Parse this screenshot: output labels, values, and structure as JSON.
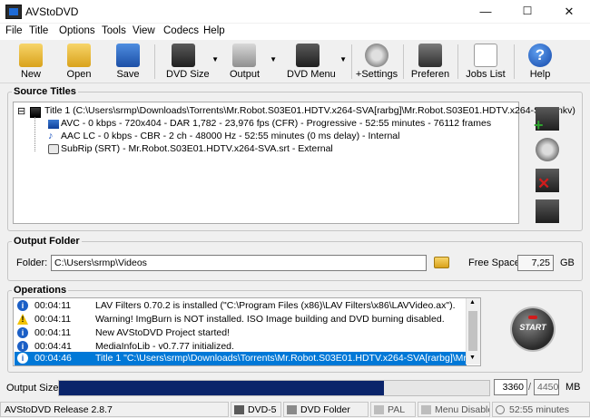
{
  "window": {
    "title": "AVStoDVD",
    "minimize": "—",
    "maximize": "☐",
    "close": "✕"
  },
  "menu": [
    "File",
    "Title",
    "Options",
    "Tools",
    "View",
    "Codecs",
    "Help"
  ],
  "toolbar": {
    "new": "New",
    "open": "Open",
    "save": "Save",
    "dvd_size": "DVD Size",
    "output": "Output",
    "dvd_menu": "DVD Menu",
    "settings": "+Settings",
    "preferences": "Preferen",
    "jobs_list": "Jobs List",
    "help": "Help"
  },
  "source_titles": {
    "label": "Source Titles",
    "expander": "⊟",
    "title": "Title 1 (C:\\Users\\srmp\\Downloads\\Torrents\\Mr.Robot.S03E01.HDTV.x264-SVA[rarbg]\\Mr.Robot.S03E01.HDTV.x264-SVA.mkv)",
    "video": "AVC - 0 kbps - 720x404 - DAR 1,782 - 23,976 fps (CFR) - Progressive - 52:55 minutes - 76112 frames",
    "audio": "AAC LC - 0 kbps - CBR - 2 ch - 48000 Hz - 52:55 minutes (0 ms delay) - Internal",
    "subtitle": "SubRip (SRT) - Mr.Robot.S03E01.HDTV.x264-SVA.srt - External"
  },
  "output_folder": {
    "label": "Output Folder",
    "folder_label": "Folder:",
    "folder_value": "C:\\Users\\srmp\\Videos",
    "free_space_label": "Free Space:",
    "free_space_value": "7,25",
    "free_space_unit": "GB"
  },
  "operations": {
    "label": "Operations",
    "rows": [
      {
        "type": "info",
        "time": "00:04:11",
        "text": "LAV Filters 0.70.2 is installed (\"C:\\Program Files (x86)\\LAV Filters\\x86\\LAVVideo.ax\")."
      },
      {
        "type": "warning",
        "time": "00:04:11",
        "text": "Warning! ImgBurn is NOT installed. ISO Image building and DVD burning disabled."
      },
      {
        "type": "info",
        "time": "00:04:11",
        "text": "New AVStoDVD Project started!"
      },
      {
        "type": "info",
        "time": "00:04:41",
        "text": "MediaInfoLib - v0.7.77 initialized."
      },
      {
        "type": "info",
        "time": "00:04:46",
        "text": "Title 1 \"C:\\Users\\srmp\\Downloads\\Torrents\\Mr.Robot.S03E01.HDTV.x264-SVA[rarbg]\\Mr.Robot.S03..."
      }
    ],
    "start_label": "START"
  },
  "output_size": {
    "label": "Output Size",
    "fill_fraction": 0.755,
    "used": "3360",
    "total": "4450",
    "unit": "MB"
  },
  "status": {
    "release": "AVStoDVD Release 2.8.7",
    "dvd_type": "DVD-5",
    "output_type": "DVD Folder",
    "video_standard": "PAL",
    "menu": "Menu Disabled",
    "duration": "52:55 minutes"
  },
  "colors": {
    "accent": "#0078d7",
    "selection": "#0078d7",
    "progress": "#0a246a",
    "info": "#1b5fc6",
    "warning": "#f2c200"
  }
}
